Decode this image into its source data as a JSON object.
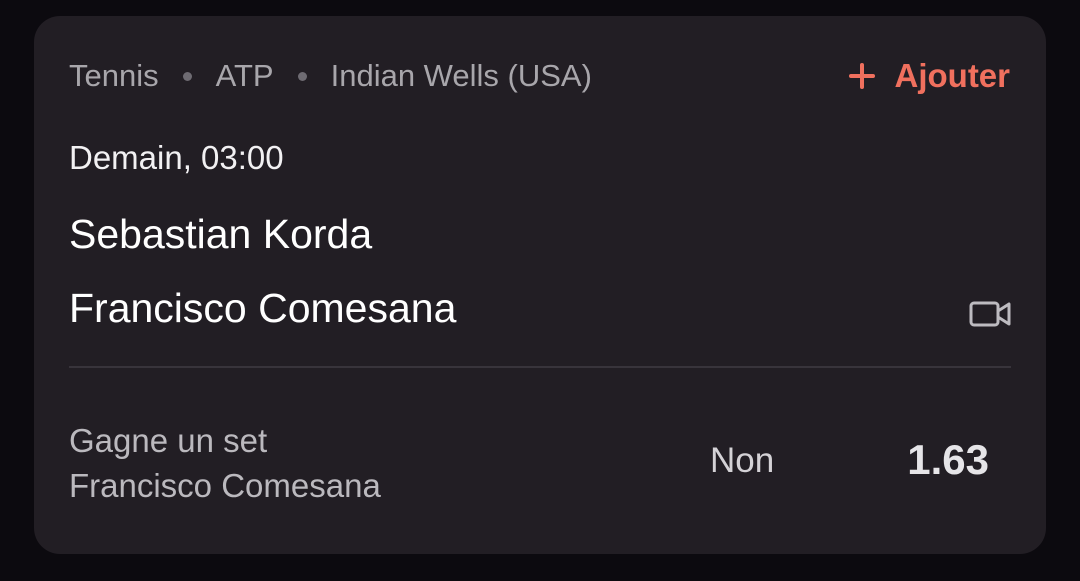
{
  "breadcrumb": {
    "sport": "Tennis",
    "competition": "ATP",
    "tournament": "Indian Wells (USA)"
  },
  "add_button": {
    "label": "Ajouter",
    "icon": "plus-icon"
  },
  "match": {
    "datetime": "Demain, 03:00",
    "player1": "Sebastian Korda",
    "player2": "Francisco Comesana",
    "stream_icon": "video-camera-icon"
  },
  "bet": {
    "market_line1": "Gagne un set",
    "market_line2": "Francisco Comesana",
    "selection": "Non",
    "odds": "1.63"
  },
  "colors": {
    "background": "#0c0a0f",
    "card": "#221e24",
    "accent": "#f0705e",
    "muted_text": "#a8a6ab"
  }
}
